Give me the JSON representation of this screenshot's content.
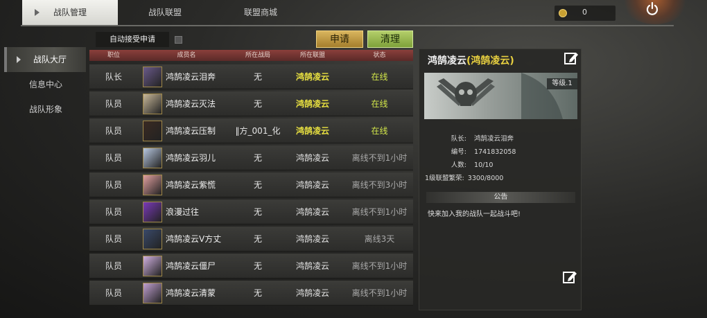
{
  "top_tabs": [
    {
      "label": "战队管理",
      "active": true
    },
    {
      "label": "战队联盟",
      "active": false
    },
    {
      "label": "联盟商城",
      "active": false
    }
  ],
  "currency": {
    "value": "0",
    "icon": "coin-icon",
    "color": "#c8a032"
  },
  "power_icon": "power-icon",
  "sidebar": {
    "items": [
      {
        "label": "战队大厅",
        "active": true
      },
      {
        "label": "信息中心",
        "active": false
      },
      {
        "label": "战队形象",
        "active": false
      }
    ]
  },
  "controls": {
    "auto_accept_label": "自动接受申请",
    "auto_accept_checked": false,
    "apply_label": "申请",
    "clean_label": "清理"
  },
  "table": {
    "headers": [
      "职位",
      "成员名",
      "所在战局",
      "所在联盟",
      "状态"
    ],
    "rows": [
      {
        "role": "队长",
        "name": "鸿鹄凌云泪奔",
        "game": "无",
        "alliance": "鸿鹄凌云",
        "status": "在线",
        "online": true
      },
      {
        "role": "队员",
        "name": "鸿鹄凌云灭法",
        "game": "无",
        "alliance": "鸿鹄凌云",
        "status": "在线",
        "online": true
      },
      {
        "role": "队员",
        "name": "鸿鹄凌云压制",
        "game": "‖方_001_化",
        "alliance": "鸿鹄凌云",
        "status": "在线",
        "online": true
      },
      {
        "role": "队员",
        "name": "鸿鹄凌云羽儿",
        "game": "无",
        "alliance": "鸿鹄凌云",
        "status": "离线不到1小时",
        "online": false
      },
      {
        "role": "队员",
        "name": "鸿鹄凌云紫慌",
        "game": "无",
        "alliance": "鸿鹄凌云",
        "status": "离线不到3小时",
        "online": false
      },
      {
        "role": "队员",
        "name": "浪漫过往",
        "game": "无",
        "alliance": "鸿鹄凌云",
        "status": "离线不到1小时",
        "online": false
      },
      {
        "role": "队员",
        "name": "鸿鹄凌云V方丈",
        "game": "无",
        "alliance": "鸿鹄凌云",
        "status": "离线3天",
        "online": false
      },
      {
        "role": "队员",
        "name": "鸿鹄凌云僵尸",
        "game": "无",
        "alliance": "鸿鹄凌云",
        "status": "离线不到1小时",
        "online": false
      },
      {
        "role": "队员",
        "name": "鸿鹄凌云清蒙",
        "game": "无",
        "alliance": "鸿鹄凌云",
        "status": "离线不到1小时",
        "online": false
      }
    ]
  },
  "team_panel": {
    "title": "鸿鹄凌云",
    "title_suffix": "(鸿鹄凌云)",
    "level": "等级.1",
    "info": [
      {
        "label": "队长:",
        "value": "鸿鹄凌云泪奔"
      },
      {
        "label": "编号:",
        "value": "1741832058"
      },
      {
        "label": "人数:",
        "value": "10/10"
      },
      {
        "label": "1级联盟繁荣:",
        "value": "3300/8000"
      }
    ],
    "notice_header": "公告",
    "notice_text": "快来加入我的战队一起战斗吧!"
  }
}
